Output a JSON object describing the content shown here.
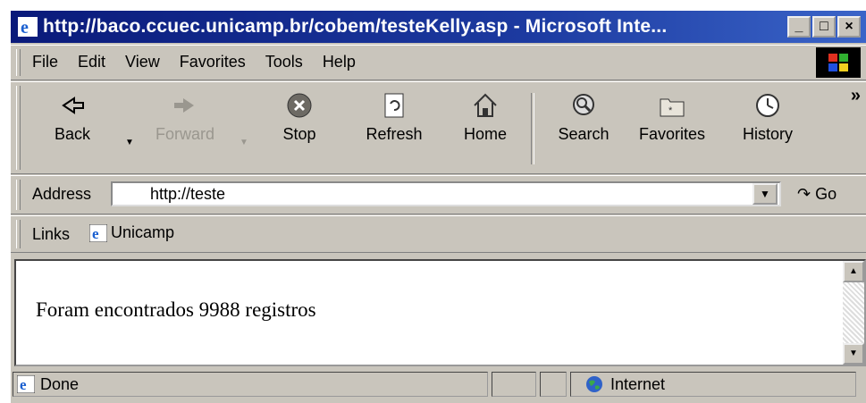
{
  "window": {
    "title": "http://baco.ccuec.unicamp.br/cobem/testeKelly.asp - Microsoft Inte...",
    "controls": [
      "_",
      "□",
      "×"
    ]
  },
  "menu": {
    "items": [
      {
        "label": "File"
      },
      {
        "label": "Edit"
      },
      {
        "label": "View"
      },
      {
        "label": "Favorites"
      },
      {
        "label": "Tools"
      },
      {
        "label": "Help"
      }
    ]
  },
  "toolbar": {
    "buttons": [
      {
        "label": "Back",
        "icon": "back-arrow-icon"
      },
      {
        "label": "Forward",
        "icon": "forward-arrow-icon"
      },
      {
        "label": "Stop",
        "icon": "stop-icon"
      },
      {
        "label": "Refresh",
        "icon": "refresh-icon"
      },
      {
        "label": "Home",
        "icon": "home-icon"
      },
      {
        "label": "Search",
        "icon": "search-icon"
      },
      {
        "label": "Favorites",
        "icon": "favorites-icon"
      },
      {
        "label": "History",
        "icon": "history-icon"
      }
    ],
    "more": "»"
  },
  "address": {
    "label": "Address",
    "value": "http://teste",
    "go_label": "Go"
  },
  "links": {
    "label": "Links",
    "item": "Unicamp"
  },
  "page": {
    "message": "Foram encontrados 9988 registros"
  },
  "status": {
    "text": "Done",
    "zone": "Internet"
  }
}
